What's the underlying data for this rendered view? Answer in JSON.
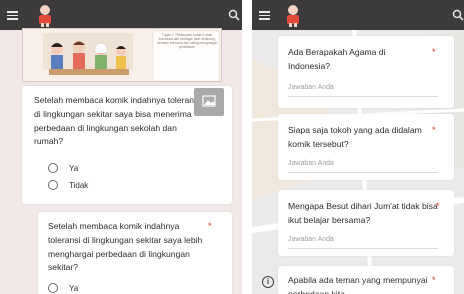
{
  "left": {
    "comic": {
      "caption": "Tugas 2, Pertanyaan untuk 6 anak Indonesia dari berbagai latar belakang, bermain bersama dan saling menghargai perbedaan",
      "page": "10"
    },
    "questions": [
      {
        "text": "Setelah membaca komik indahnya toleransi di lingkungan sekitar saya bisa menerima perbedaan di lingkungan sekolah dan rumah?",
        "options": [
          "Ya",
          "Tidak"
        ]
      },
      {
        "text": "Setelah membaca komik indahnya toleransi di lingkungan sekitar saya lebih menghargai perbedaan di lingkungan sekitar?",
        "required": "*",
        "options": [
          "Ya"
        ]
      }
    ]
  },
  "right": {
    "questions": [
      {
        "text": "Ada Berapakah Agama di Indonesia?",
        "required": "*",
        "answer_placeholder": "Jawaban Anda"
      },
      {
        "text": "Siapa saja tokoh yang ada didalam komik tersebut?",
        "required": "*",
        "answer_placeholder": "Jawaban Anda"
      },
      {
        "text": "Mengapa Besut dihari Jum'at tidak bisa ikut belajar bersama?",
        "required": "*",
        "answer_placeholder": "Jawaban Anda"
      },
      {
        "text": "Apabila ada teman yang mempunyai perbedaan kita",
        "required": "*"
      }
    ]
  },
  "colors": {
    "topbar": "#3d3a3c",
    "background_left": "#f0e7e6",
    "background_right": "#ece9ea",
    "required": "#d93025"
  },
  "icons": [
    "menu-icon",
    "avatar-icon",
    "search-icon",
    "image-icon",
    "radio-icon",
    "info-icon"
  ]
}
